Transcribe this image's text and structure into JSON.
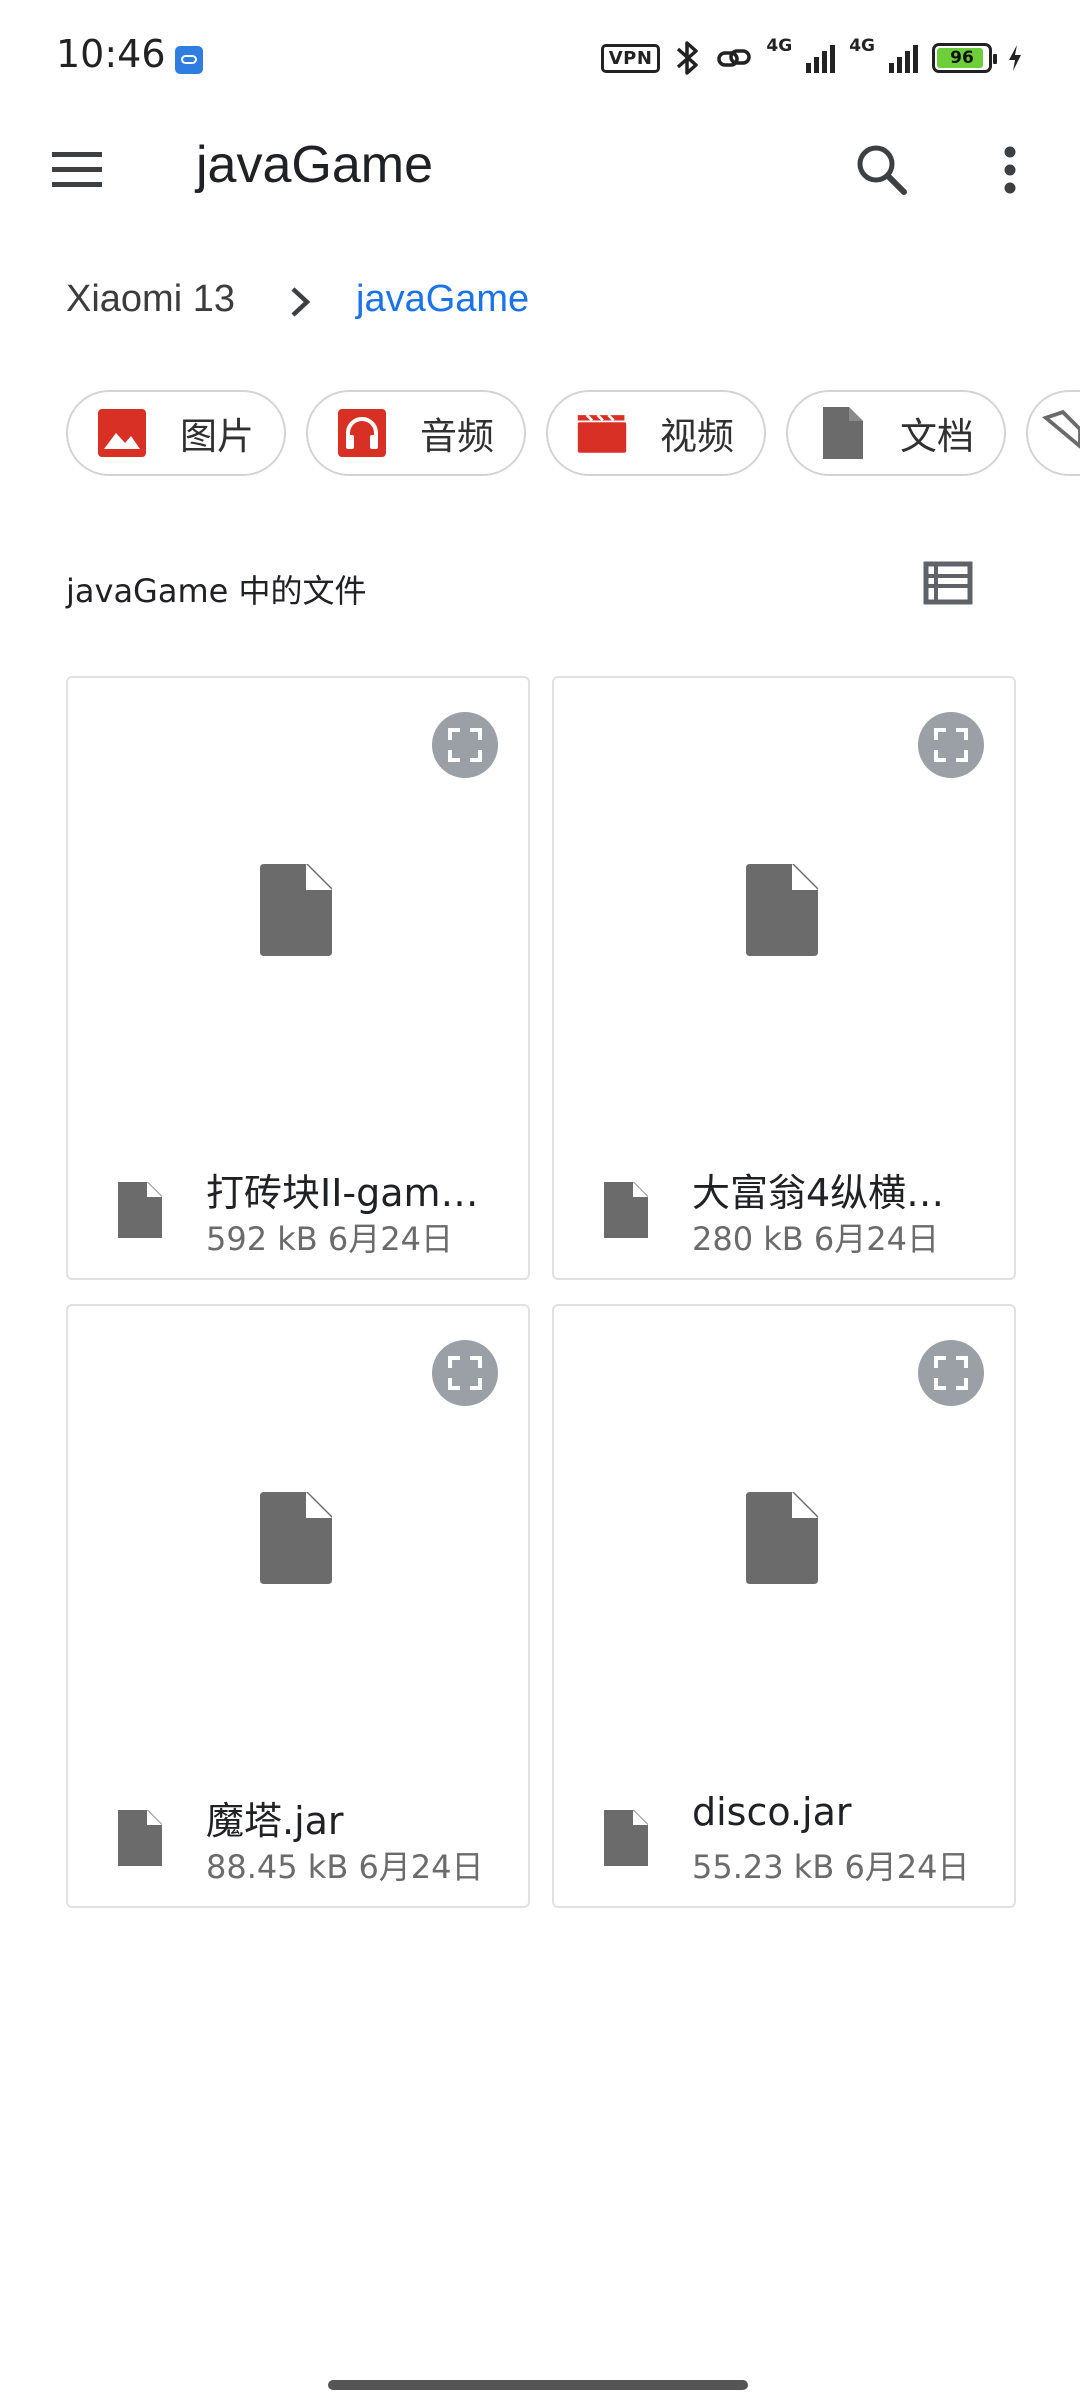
{
  "status_bar": {
    "time": "10:46",
    "vpn": "VPN",
    "net1": "4G",
    "net2": "4G",
    "battery": "96",
    "battery_color": "#6ccf3a"
  },
  "app_bar": {
    "title": "javaGame",
    "menu_icon": "menu-icon",
    "search_icon": "search-icon",
    "more_icon": "more-vert-icon"
  },
  "breadcrumb": {
    "root": "Xiaomi 13",
    "current": "javaGame",
    "current_color": "#1a73e8"
  },
  "chips": [
    {
      "label": "图片",
      "icon": "image-icon",
      "color": "#d93025"
    },
    {
      "label": "音频",
      "icon": "headphones-icon",
      "color": "#d93025"
    },
    {
      "label": "视频",
      "icon": "video-icon",
      "color": "#d93025"
    },
    {
      "label": "文档",
      "icon": "document-icon",
      "color": "#6b6b6b"
    }
  ],
  "section": {
    "title": "javaGame 中的文件",
    "view_icon": "list-view-icon"
  },
  "files": [
    {
      "name": "打砖块II-gam…",
      "size": "592 kB",
      "date": "6月24日"
    },
    {
      "name": "大富翁4纵横…",
      "size": "280 kB",
      "date": "6月24日"
    },
    {
      "name": "魔塔.jar",
      "size": "88.45 kB",
      "date": "6月24日"
    },
    {
      "name": "disco.jar",
      "size": "55.23 kB",
      "date": "6月24日"
    }
  ]
}
